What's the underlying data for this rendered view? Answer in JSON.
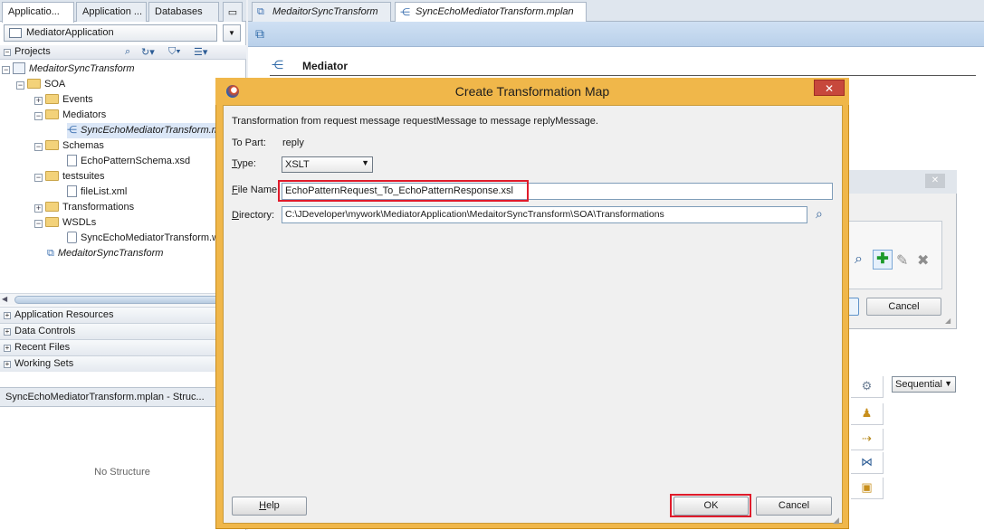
{
  "left_tabs": [
    "Applicatio...",
    "Application ...",
    "Databases"
  ],
  "app_selector": "MediatorApplication",
  "projects_label": "Projects",
  "tree": [
    {
      "label": "MedaitorSyncTransform",
      "italic": true
    },
    {
      "label": "SOA"
    },
    {
      "label": "Events"
    },
    {
      "label": "Mediators"
    },
    {
      "label": "SyncEchoMediatorTransform.m",
      "italic": true
    },
    {
      "label": "Schemas"
    },
    {
      "label": "EchoPatternSchema.xsd"
    },
    {
      "label": "testsuites"
    },
    {
      "label": "fileList.xml"
    },
    {
      "label": "Transformations"
    },
    {
      "label": "WSDLs"
    },
    {
      "label": "SyncEchoMediatorTransform.w"
    },
    {
      "label": "MedaitorSyncTransform",
      "italic": true
    }
  ],
  "accordion": [
    "Application Resources",
    "Data Controls",
    "Recent Files",
    "Working Sets"
  ],
  "structure_tab": "SyncEchoMediatorTransform.mplan - Struc...",
  "no_structure": "No Structure",
  "editor_tabs": [
    "MedaitorSyncTransform",
    "SyncEchoMediatorTransform.mplan"
  ],
  "mediator_header": "Mediator",
  "bg_cancel": "Cancel",
  "sequential": "Sequential",
  "dialog": {
    "title": "Create Transformation Map",
    "description": "Transformation from request message requestMessage to message replyMessage.",
    "to_part_label": "To Part:",
    "to_part_value": "reply",
    "type_label": "Type:",
    "type_value": "XSLT",
    "file_name_label": "File Name:",
    "file_name_value": "EchoPatternRequest_To_EchoPatternResponse.xsl",
    "directory_label": "Directory:",
    "directory_value": "C:\\JDeveloper\\mywork\\MediatorApplication\\MedaitorSyncTransform\\SOA\\Transformations",
    "help": "Help",
    "ok": "OK",
    "cancel": "Cancel"
  }
}
